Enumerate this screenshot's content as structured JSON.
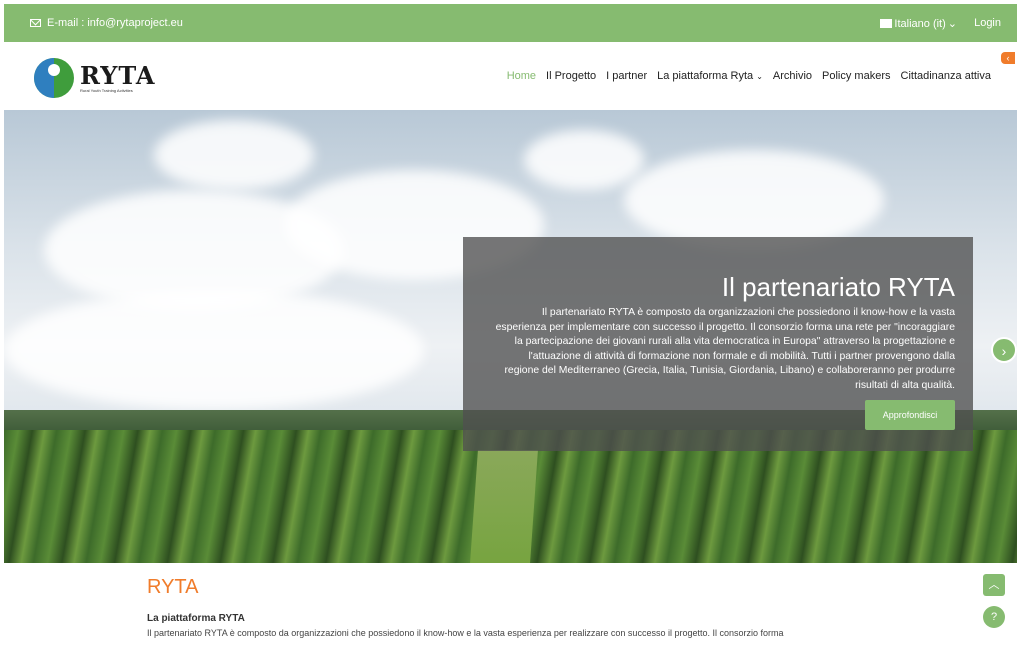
{
  "topbar": {
    "email_text": "E-mail : info@rytaproject.eu",
    "language": "Italiano (it)",
    "language_chevron": "⌄",
    "login": "Login"
  },
  "logo": {
    "name": "RYTA",
    "tagline": "Rural Youth Training Activities"
  },
  "nav": {
    "items": [
      "Home",
      "Il Progetto",
      "I partner",
      "La piattaforma Ryta",
      "Archivio",
      "Policy makers",
      "Cittadinanza attiva"
    ],
    "dropdown_chevron": "⌄",
    "active_index": 0
  },
  "hero": {
    "title": "Il partenariato RYTA",
    "text": "Il partenariato RYTA è composto da organizzazioni che possiedono il know-how e la vasta esperienza per implementare con successo il progetto. Il consorzio forma una rete per \"incoraggiare la partecipazione dei giovani rurali alla vita democratica in Europa\" attraverso la progettazione e l'attuazione di attività di formazione non formale e di mobilità. Tutti i partner provengono dalla regione del Mediterraneo (Grecia, Italia, Tunisia, Giordania, Libano) e collaboreranno per produrre risultati di alta qualità.",
    "button": "Approfondisci",
    "next_icon": "chevron-right-icon"
  },
  "section": {
    "title": "RYTA",
    "subtitle": "La piattaforma RYTA",
    "body": "Il partenariato RYTA è composto da organizzazioni che possiedono il know-how e la vasta esperienza per realizzare con successo il progetto. Il consorzio forma"
  },
  "colors": {
    "accent": "#86bb70",
    "orange": "#f07c2b"
  }
}
